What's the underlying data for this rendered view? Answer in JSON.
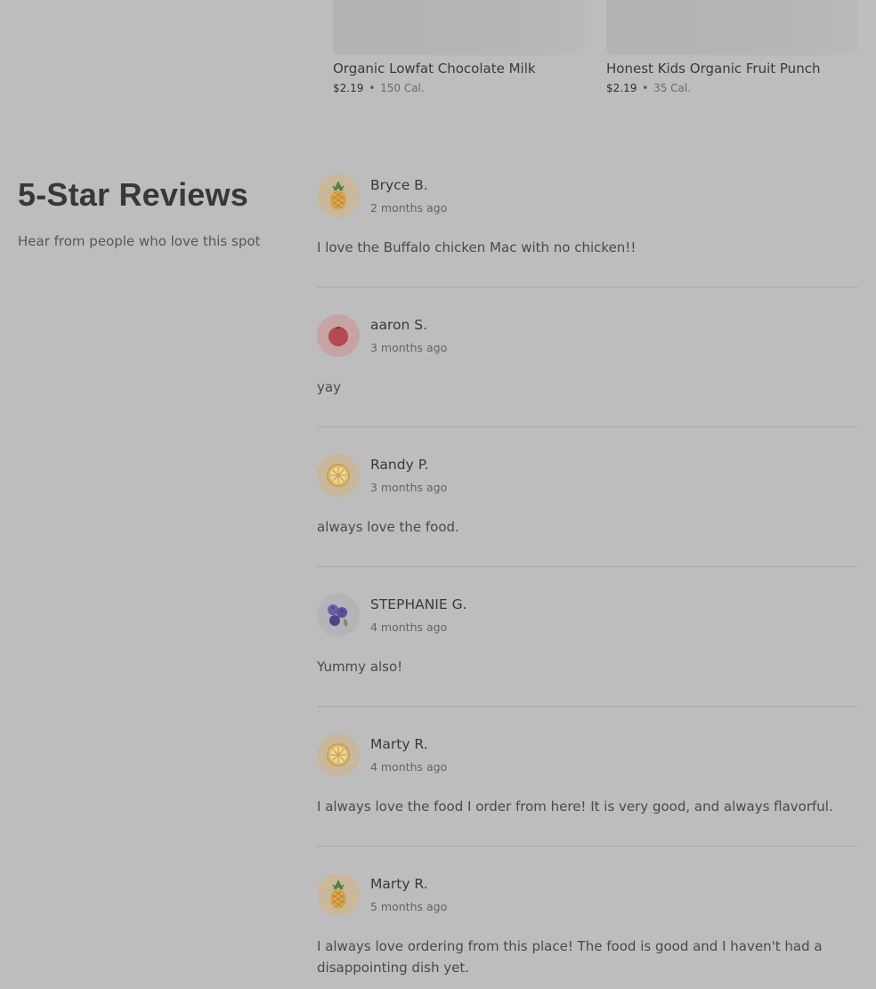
{
  "products": [
    {
      "name": "Organic Lowfat Chocolate Milk",
      "price": "$2.19",
      "separator": "•",
      "calories": "150 Cal."
    },
    {
      "name": "Honest Kids Organic Fruit Punch",
      "price": "$2.19",
      "separator": "•",
      "calories": "35 Cal."
    }
  ],
  "reviews_section": {
    "title": "5-Star Reviews",
    "subtitle": "Hear from people who love this spot"
  },
  "reviews": [
    {
      "name": "Bryce B.",
      "date": "2 months ago",
      "text": "I love the Buffalo chicken Mac with no chicken!!",
      "avatar_icon": "pineapple-icon"
    },
    {
      "name": "aaron S.",
      "date": "3 months ago",
      "text": "yay",
      "avatar_icon": "tomato-icon"
    },
    {
      "name": "Randy P.",
      "date": "3 months ago",
      "text": "always love the food.",
      "avatar_icon": "lemon-slice-icon"
    },
    {
      "name": "STEPHANIE G.",
      "date": "4 months ago",
      "text": "Yummy also!",
      "avatar_icon": "blueberries-icon"
    },
    {
      "name": "Marty R.",
      "date": "4 months ago",
      "text": "I always love the food I order from here! It is very good, and always flavorful.",
      "avatar_icon": "lemon-slice-icon"
    },
    {
      "name": "Marty R.",
      "date": "5 months ago",
      "text": "I always love ordering from this place! The food is good and I haven't had a disappointing dish yet.",
      "avatar_icon": "pineapple-icon"
    }
  ]
}
